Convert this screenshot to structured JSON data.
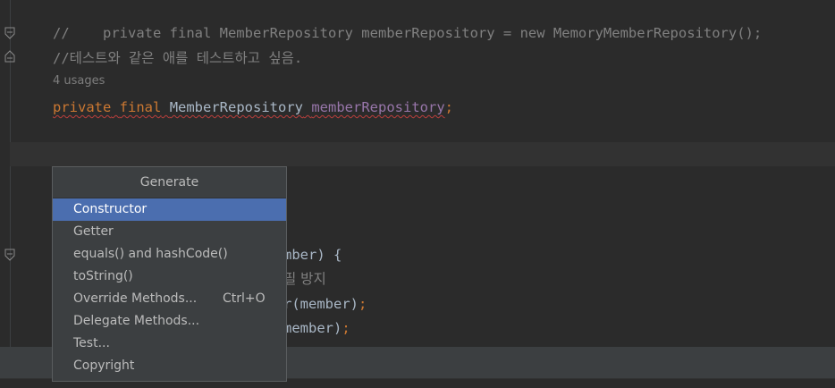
{
  "editor": {
    "line1_comment_prefix": "//",
    "line1_comment_body": "    private final MemberRepository memberRepository = new MemoryMemberRepository();",
    "line2_comment": "//테스트와 같은 애를 테스트하고 싶음.",
    "usages": "4 usages",
    "line3_kw_private": "private",
    "line3_kw_final": "final",
    "line3_type": "MemberRepository",
    "line3_field": "memberRepository",
    "line3_semi": ";",
    "line5_code": "mber) {",
    "line6_comment": "필 방지",
    "line7_code": "r(member)",
    "line7_semi": ";",
    "line8_code": "member)",
    "line8_semi": ";"
  },
  "popup": {
    "title": "Generate",
    "items": [
      {
        "label": "Constructor",
        "shortcut": "",
        "selected": true
      },
      {
        "label": "Getter",
        "shortcut": ""
      },
      {
        "label": "equals() and hashCode()",
        "shortcut": ""
      },
      {
        "label": "toString()",
        "shortcut": ""
      },
      {
        "label": "Override Methods...",
        "shortcut": "Ctrl+O"
      },
      {
        "label": "Delegate Methods...",
        "shortcut": ""
      },
      {
        "label": "Test...",
        "shortcut": ""
      },
      {
        "label": "Copyright",
        "shortcut": ""
      }
    ]
  },
  "colors": {
    "background": "#2b2b2b",
    "keyword": "#cc7832",
    "comment": "#808080",
    "field": "#9876aa",
    "selection": "#4b6eaf"
  },
  "icons": {
    "fold_top": "fold-open-icon",
    "fold_bottom": "fold-close-icon"
  }
}
